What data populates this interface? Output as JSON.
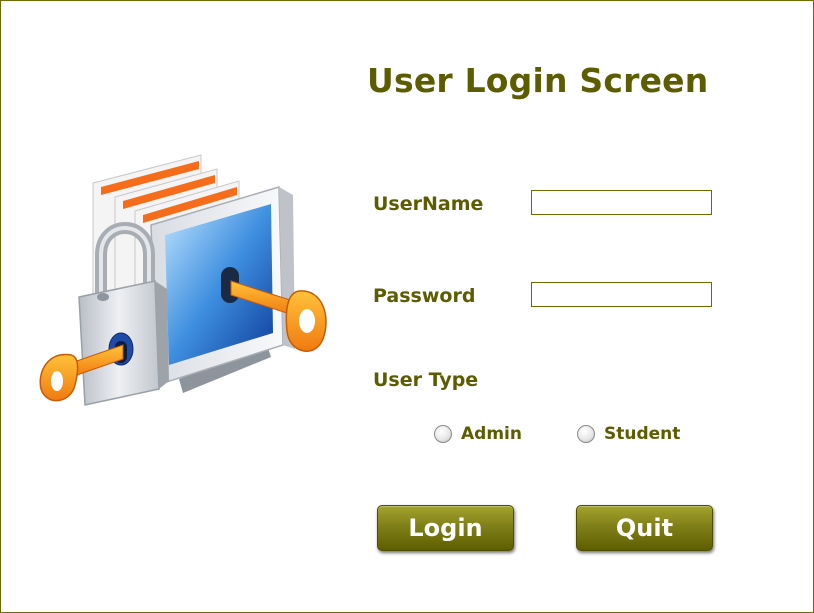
{
  "login": {
    "title": "User Login Screen",
    "username_label": "UserName",
    "username_value": "",
    "password_label": "Password",
    "password_value": "",
    "user_type_label": "User Type",
    "options": [
      "Admin",
      "Student"
    ],
    "login_button": "Login",
    "quit_button": "Quit"
  },
  "colors": {
    "text": "#5c5c00",
    "border": "#6b6b00",
    "button": "#80801a"
  },
  "icons": [
    "security-illustration-icon",
    "padlock-icon",
    "key-icon",
    "monitor-icon",
    "document-icon"
  ]
}
